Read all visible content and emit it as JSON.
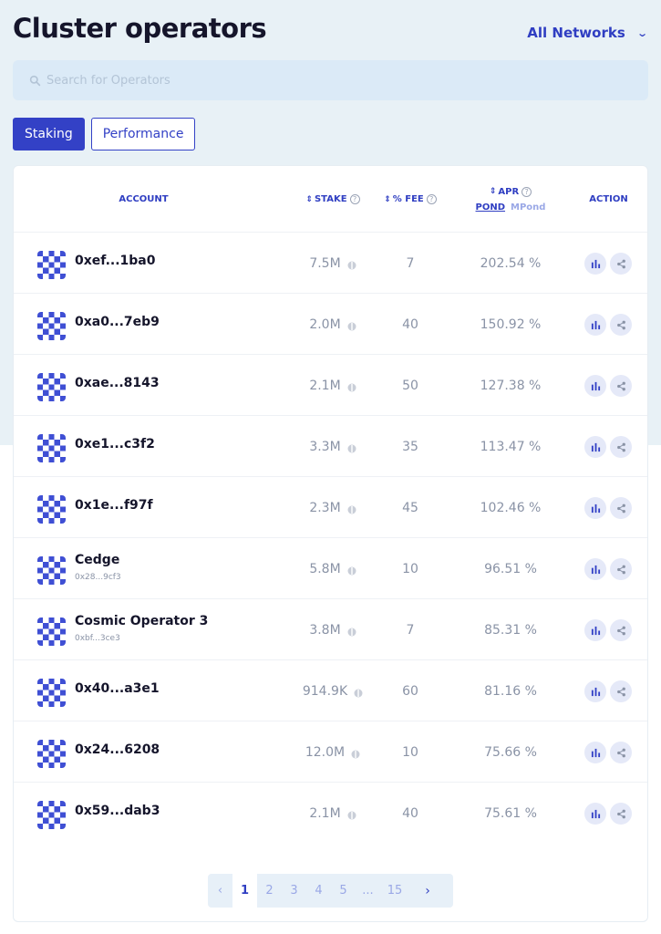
{
  "header": {
    "title": "Cluster operators",
    "network": "All Networks"
  },
  "search": {
    "placeholder": "Search for Operators",
    "value": ""
  },
  "tabs": [
    {
      "label": "Staking",
      "active": true
    },
    {
      "label": "Performance",
      "active": false
    }
  ],
  "table": {
    "columns": {
      "account": "ACCOUNT",
      "stake": "STAKE",
      "fee": "% FEE",
      "apr": "APR",
      "apr_pond": "POND",
      "apr_mpond": "MPond",
      "action": "ACTION"
    },
    "rows": [
      {
        "name": "0xef...1ba0",
        "address": "",
        "stake": "7.5M",
        "fee": "7",
        "apr": "202.54 %"
      },
      {
        "name": "0xa0...7eb9",
        "address": "",
        "stake": "2.0M",
        "fee": "40",
        "apr": "150.92 %"
      },
      {
        "name": "0xae...8143",
        "address": "",
        "stake": "2.1M",
        "fee": "50",
        "apr": "127.38 %"
      },
      {
        "name": "0xe1...c3f2",
        "address": "",
        "stake": "3.3M",
        "fee": "35",
        "apr": "113.47 %"
      },
      {
        "name": "0x1e...f97f",
        "address": "",
        "stake": "2.3M",
        "fee": "45",
        "apr": "102.46 %"
      },
      {
        "name": "Cedge",
        "address": "0x28...9cf3",
        "stake": "5.8M",
        "fee": "10",
        "apr": "96.51 %"
      },
      {
        "name": "Cosmic Operator 3",
        "address": "0xbf...3ce3",
        "stake": "3.8M",
        "fee": "7",
        "apr": "85.31 %"
      },
      {
        "name": "0x40...a3e1",
        "address": "",
        "stake": "914.9K",
        "fee": "60",
        "apr": "81.16 %"
      },
      {
        "name": "0x24...6208",
        "address": "",
        "stake": "12.0M",
        "fee": "10",
        "apr": "75.66 %"
      },
      {
        "name": "0x59...dab3",
        "address": "",
        "stake": "2.1M",
        "fee": "40",
        "apr": "75.61 %"
      }
    ]
  },
  "pagination": {
    "prev": "‹",
    "pages": [
      "1",
      "2",
      "3",
      "4",
      "5",
      "...",
      "15"
    ],
    "current": "1",
    "next": "›"
  },
  "colors": {
    "accent": "#3341c6",
    "page_bg": "#e8f1f6",
    "avatar_a": "#3f4fd4",
    "avatar_b": "#ffffff"
  },
  "icons": {
    "search": "search-icon",
    "network_dropdown": "chevron-down-icon",
    "stake_token": "coin-icon",
    "help": "question-mark-icon",
    "sort": "sort-icon",
    "action_stats": "bar-chart-icon",
    "action_share": "share-icon"
  }
}
